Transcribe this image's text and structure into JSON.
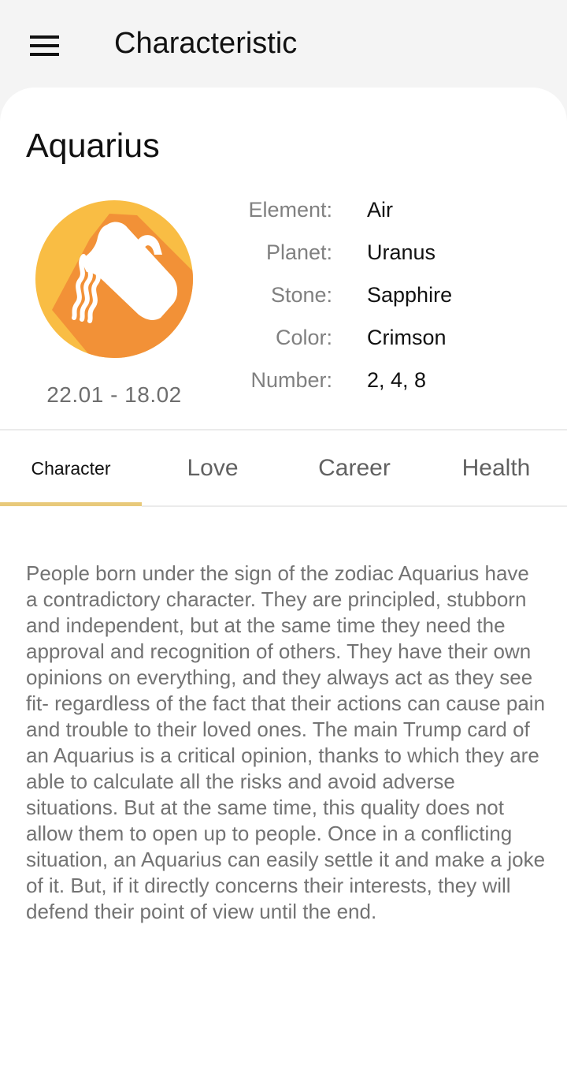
{
  "appbar": {
    "menu_icon": "hamburger-menu-icon",
    "title": "Characteristic"
  },
  "sign": {
    "name": "Aquarius",
    "icon": "aquarius-water-bearer-icon",
    "date_range": "22.01 - 18.02",
    "colors": {
      "circle_light": "#f9bd44",
      "circle_shadow": "#f29137",
      "glyph": "#ffffff"
    }
  },
  "properties": [
    {
      "label": "Element:",
      "value": "Air"
    },
    {
      "label": "Planet:",
      "value": "Uranus"
    },
    {
      "label": "Stone:",
      "value": "Sapphire"
    },
    {
      "label": "Color:",
      "value": "Crimson"
    },
    {
      "label": "Number:",
      "value": "2, 4, 8"
    }
  ],
  "tabs": [
    {
      "label": "Character",
      "active": true
    },
    {
      "label": "Love",
      "active": false
    },
    {
      "label": "Career",
      "active": false
    },
    {
      "label": "Health",
      "active": false
    }
  ],
  "accent_color": "#e8c97a",
  "content": {
    "text": "People born under the sign of the zodiac Aquarius have a contradictory character. They are principled, stubborn and independent, but at the same time they need the approval and recognition of others. They have their own opinions on everything, and they always act as they see fit- regardless of the fact that their actions can cause pain and trouble to their loved ones. The main Trump card of an Aquarius is a critical opinion, thanks to which they are able to calculate all the risks and avoid adverse situations. But at the same time, this quality does not allow them to open up to people. Once in a conflicting situation, an Aquarius can easily settle it and make a joke of it. But, if it directly concerns their interests, they will defend their point of view until the end."
  }
}
